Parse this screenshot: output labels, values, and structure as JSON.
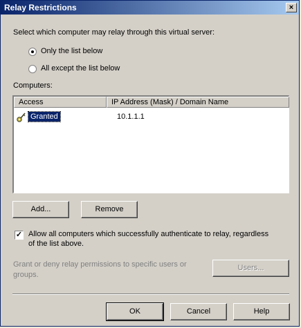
{
  "window": {
    "title": "Relay Restrictions",
    "close": "×"
  },
  "prompt": "Select which computer may relay through this virtual server:",
  "radios": {
    "only_list": "Only the list below",
    "all_except": "All except the list below"
  },
  "computers_label": "Computers:",
  "list": {
    "columns": [
      "Access",
      "IP Address (Mask) / Domain Name"
    ],
    "rows": [
      {
        "access": "Granted",
        "address": "10.1.1.1"
      }
    ]
  },
  "buttons": {
    "add": "Add...",
    "remove": "Remove",
    "users": "Users...",
    "ok": "OK",
    "cancel": "Cancel",
    "help": "Help"
  },
  "allow_auth": {
    "line1": "Allow all computers which successfully authenticate to relay, regardless",
    "line2": "of the list above."
  },
  "grant_text": {
    "line1": "Grant or deny relay permissions to specific users or",
    "line2": "groups."
  },
  "icons": {
    "key": "key-icon"
  },
  "colors": {
    "titlebar": "#0a246a",
    "selection": "#0a246a",
    "face": "#d4d0c8"
  }
}
